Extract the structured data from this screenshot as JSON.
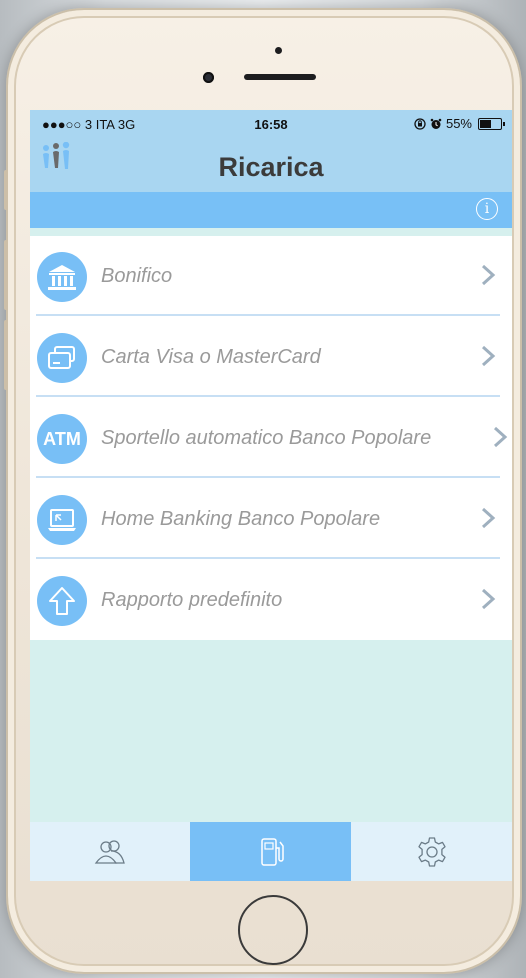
{
  "status_bar": {
    "carrier": "●●●○○ 3 ITA  3G",
    "time": "16:58",
    "battery_percent": "55%"
  },
  "nav": {
    "title": "Ricarica",
    "logo_icon": "people-logo-icon",
    "info_icon": "info-icon"
  },
  "options": [
    {
      "label": "Bonifico",
      "icon": "bank-icon"
    },
    {
      "label": "Carta Visa o MasterCard",
      "icon": "credit-card-icon"
    },
    {
      "label": "Sportello automatico Banco Popolare",
      "icon": "atm-icon",
      "icon_text": "ATM"
    },
    {
      "label": "Home Banking Banco Popolare",
      "icon": "laptop-icon"
    },
    {
      "label": "Rapporto predefinito",
      "icon": "up-arrow-icon"
    }
  ],
  "tabs": [
    {
      "name": "contacts",
      "icon": "users-icon",
      "active": false
    },
    {
      "name": "recharge",
      "icon": "fuel-pump-icon",
      "active": true
    },
    {
      "name": "settings",
      "icon": "gear-icon",
      "active": false
    }
  ],
  "colors": {
    "accent": "#78bff6",
    "header": "#a9d6f1",
    "separator": "#c7dff4",
    "label_text": "#9a9a9a"
  }
}
